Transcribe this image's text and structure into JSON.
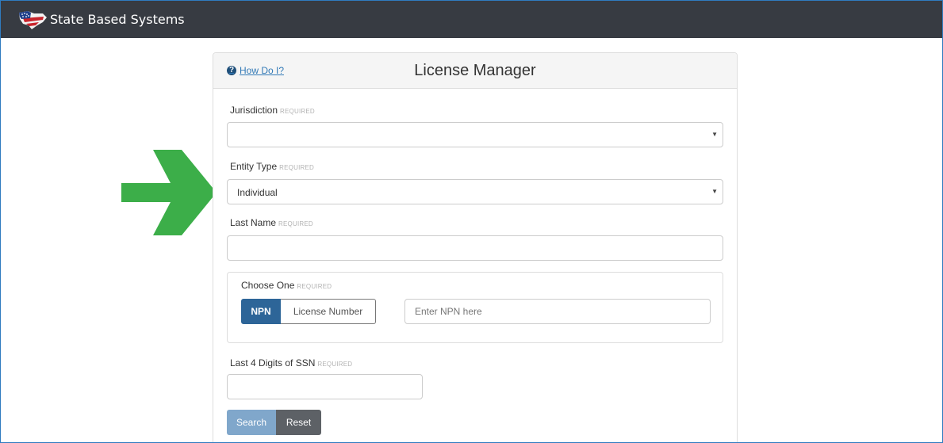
{
  "header": {
    "brand_title": "State Based Systems",
    "background_color": "#373b42"
  },
  "panel": {
    "help_link": "How Do I?",
    "title": "License Manager"
  },
  "required_tag": "REQUIRED",
  "fields": {
    "jurisdiction": {
      "label": "Jurisdiction",
      "value": ""
    },
    "entity_type": {
      "label": "Entity Type",
      "value": "Individual"
    },
    "last_name": {
      "label": "Last Name",
      "value": ""
    },
    "choose_one": {
      "label": "Choose One",
      "options": [
        "NPN",
        "License Number"
      ],
      "selected": "NPN",
      "input_placeholder": "Enter NPN here"
    },
    "ssn_last4": {
      "label": "Last 4 Digits of SSN",
      "value": ""
    }
  },
  "buttons": {
    "search": "Search",
    "reset": "Reset"
  },
  "colors": {
    "accent": "#2d6598",
    "arrow": "#3cae49",
    "link": "#337ab7"
  }
}
